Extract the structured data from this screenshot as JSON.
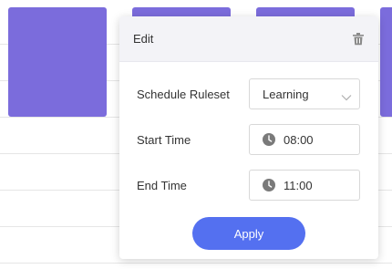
{
  "popover": {
    "title": "Edit",
    "delete_icon": "trash-icon",
    "fields": {
      "schedule_ruleset": {
        "label": "Schedule Ruleset",
        "value": "Learning"
      },
      "start_time": {
        "label": "Start Time",
        "value": "08:00"
      },
      "end_time": {
        "label": "End Time",
        "value": "11:00"
      }
    },
    "apply_label": "Apply"
  },
  "colors": {
    "event_block": "#7b6cdc",
    "apply_button": "#5470f0",
    "header_bg": "#f3f3f7"
  }
}
